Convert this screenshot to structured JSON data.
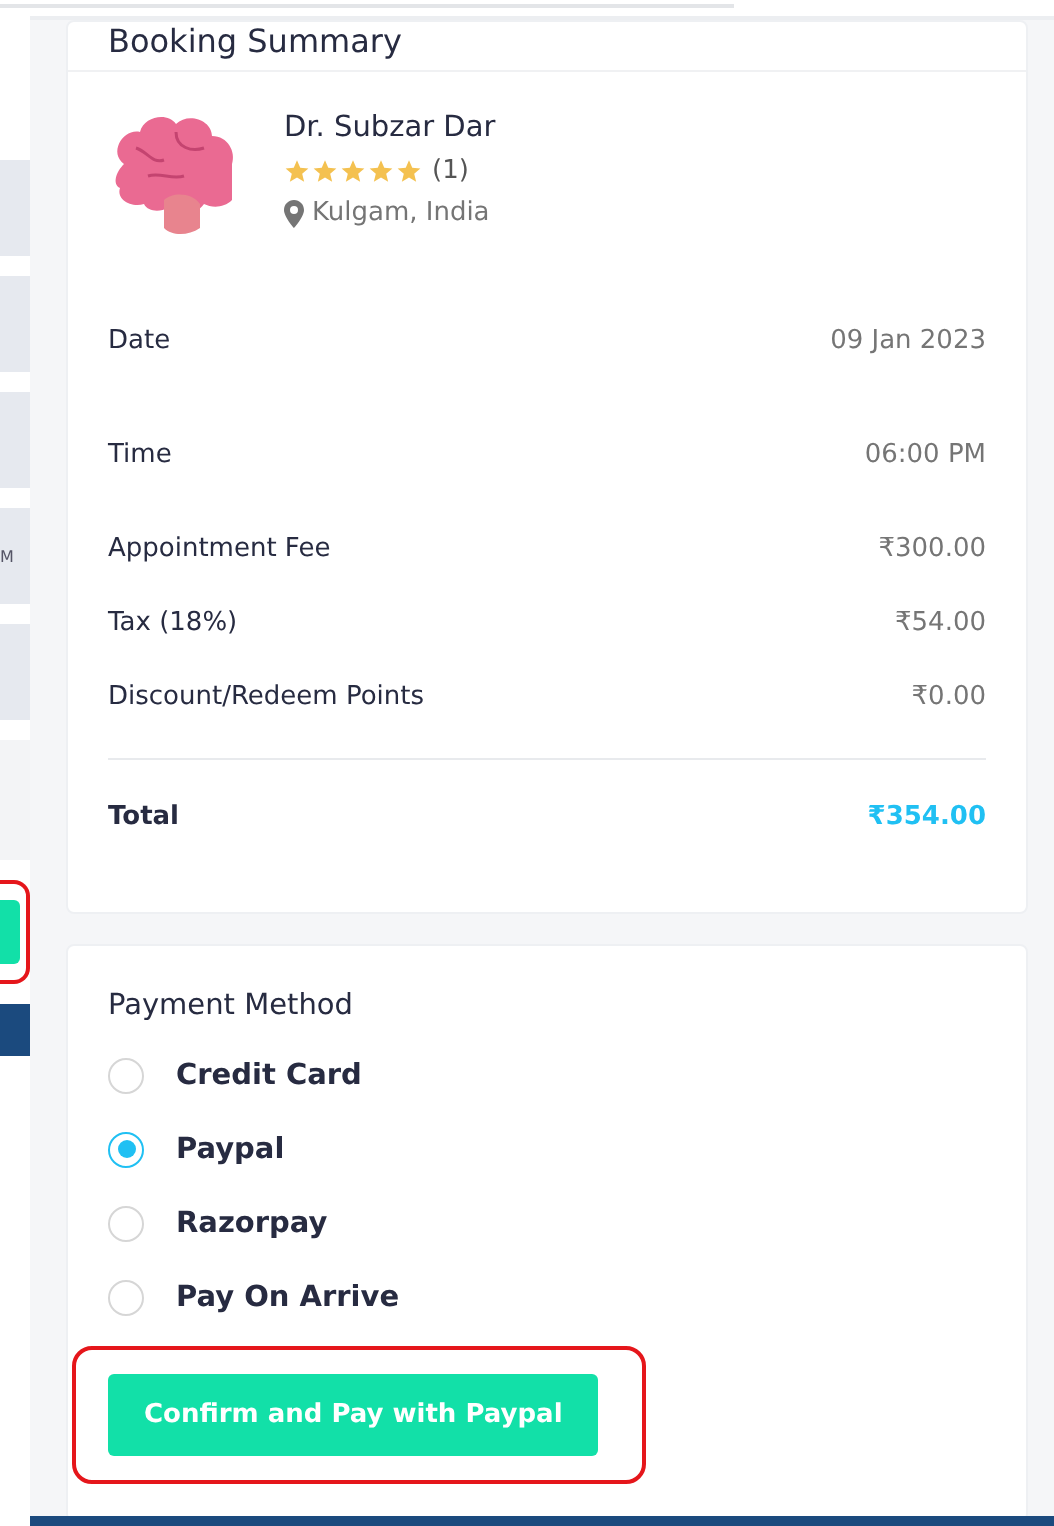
{
  "background_page": {
    "text_fragment": "M"
  },
  "booking_summary": {
    "title": "Booking Summary",
    "doctor": {
      "name": "Dr. Subzar Dar",
      "stars": 5,
      "review_count": "(1)",
      "location": "Kulgam, India"
    },
    "details": [
      {
        "label": "Date",
        "value": "09 Jan 2023",
        "kind": "spaced"
      },
      {
        "label": "Time",
        "value": "06:00 PM",
        "kind": "spaced"
      },
      {
        "label": "Appointment Fee",
        "value": "₹300.00",
        "kind": "compact"
      },
      {
        "label": "Tax (18%)",
        "value": "₹54.00",
        "kind": "compact"
      },
      {
        "label": "Discount/Redeem Points",
        "value": "₹0.00",
        "kind": "compact"
      }
    ],
    "total": {
      "label": "Total",
      "value": "₹354.00"
    }
  },
  "payment": {
    "title": "Payment Method",
    "options": [
      {
        "label": "Credit Card",
        "selected": false
      },
      {
        "label": "Paypal",
        "selected": true
      },
      {
        "label": "Razorpay",
        "selected": false
      },
      {
        "label": "Pay On Arrive",
        "selected": false
      }
    ],
    "button": "Confirm and Pay with Paypal"
  }
}
